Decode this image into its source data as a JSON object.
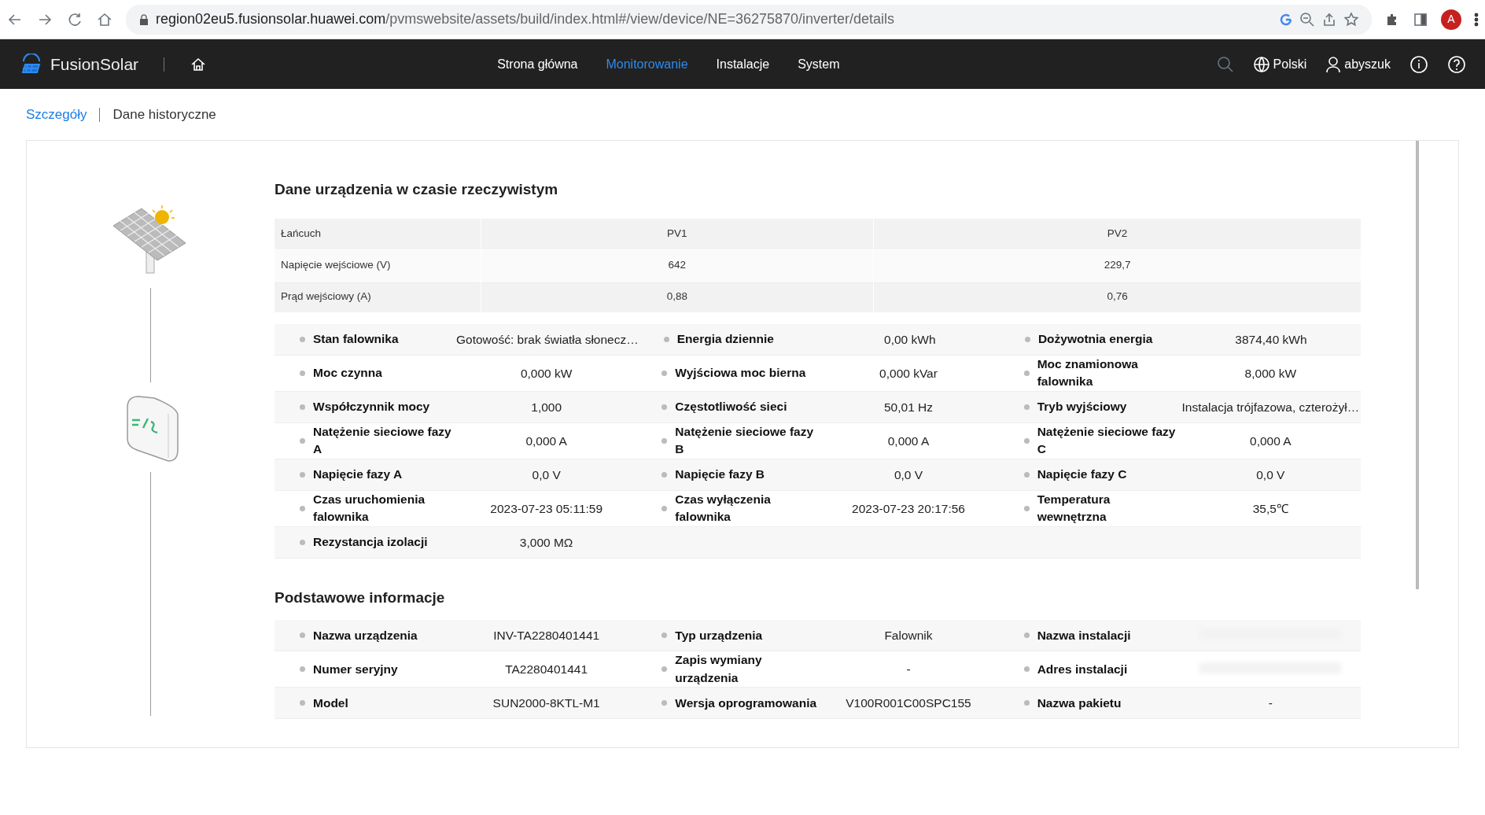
{
  "browser": {
    "url_host": "region02eu5.fusionsolar.huawei.com",
    "url_path": "/pvmswebsite/assets/build/index.html#/view/device/NE=36275870/inverter/details",
    "profile_initial": "A"
  },
  "navbar": {
    "brand": "FusionSolar",
    "items": [
      {
        "label": "Strona główna",
        "selected": false
      },
      {
        "label": "Monitorowanie",
        "selected": true
      },
      {
        "label": "Instalacje",
        "selected": false
      },
      {
        "label": "System",
        "selected": false
      }
    ],
    "language": "Polski",
    "user": "abyszuk"
  },
  "tabs": [
    {
      "label": "Szczegóły",
      "selected": true
    },
    {
      "label": "Dane historyczne",
      "selected": false
    }
  ],
  "realtime": {
    "title": "Dane urządzenia w czasie rzeczywistym",
    "table": {
      "columns": [
        "Łańcuch",
        "PV1",
        "PV2"
      ],
      "rows": [
        [
          "Napięcie wejściowe (V)",
          "642",
          "229,7"
        ],
        [
          "Prąd wejściowy (A)",
          "0,88",
          "0,76"
        ]
      ]
    },
    "rows": [
      [
        {
          "label": "Stan falownika",
          "value": "Gotowość: brak światła słonecz…"
        },
        {
          "label": "Energia dziennie",
          "value": "0,00 kWh"
        },
        {
          "label": "Dożywotnia energia",
          "value": "3874,40 kWh"
        }
      ],
      [
        {
          "label": "Moc czynna",
          "value": "0,000 kW"
        },
        {
          "label": "Wyjściowa moc bierna",
          "value": "0,000 kVar"
        },
        {
          "label": "Moc znamionowa falownika",
          "value": "8,000 kW"
        }
      ],
      [
        {
          "label": "Współczynnik mocy",
          "value": "1,000"
        },
        {
          "label": "Częstotliwość sieci",
          "value": "50,01 Hz"
        },
        {
          "label": "Tryb wyjściowy",
          "value": "Instalacja trójfazowa, czterożył…"
        }
      ],
      [
        {
          "label": "Natężenie sieciowe fazy A",
          "value": "0,000 A"
        },
        {
          "label": "Natężenie sieciowe fazy B",
          "value": "0,000 A"
        },
        {
          "label": "Natężenie sieciowe fazy C",
          "value": "0,000 A"
        }
      ],
      [
        {
          "label": "Napięcie fazy A",
          "value": "0,0 V"
        },
        {
          "label": "Napięcie fazy B",
          "value": "0,0 V"
        },
        {
          "label": "Napięcie fazy C",
          "value": "0,0 V"
        }
      ],
      [
        {
          "label": "Czas uruchomienia falownika",
          "value": "2023-07-23 05:11:59"
        },
        {
          "label": "Czas wyłączenia falownika",
          "value": "2023-07-23 20:17:56"
        },
        {
          "label": "Temperatura wewnętrzna",
          "value": "35,5℃"
        }
      ],
      [
        {
          "label": "Rezystancja izolacji",
          "value": "3,000 MΩ"
        }
      ]
    ]
  },
  "basic": {
    "title": "Podstawowe informacje",
    "rows": [
      [
        {
          "label": "Nazwa urządzenia",
          "value": "INV-TA2280401441",
          "blurred": false
        },
        {
          "label": "Typ urządzenia",
          "value": "Falownik",
          "blurred": false
        },
        {
          "label": "Nazwa instalacji",
          "blurred": true
        }
      ],
      [
        {
          "label": "Numer seryjny",
          "value": "TA2280401441",
          "blurred": false
        },
        {
          "label": "Zapis wymiany urządzenia",
          "value": "-",
          "blurred": false
        },
        {
          "label": "Adres instalacji",
          "blurred": true
        }
      ],
      [
        {
          "label": "Model",
          "value": "SUN2000-8KTL-M1",
          "blurred": false
        },
        {
          "label": "Wersja oprogramowania",
          "value": "V100R001C00SPC155",
          "blurred": false
        },
        {
          "label": "Nazwa pakietu",
          "value": "-",
          "blurred": false
        }
      ]
    ]
  }
}
